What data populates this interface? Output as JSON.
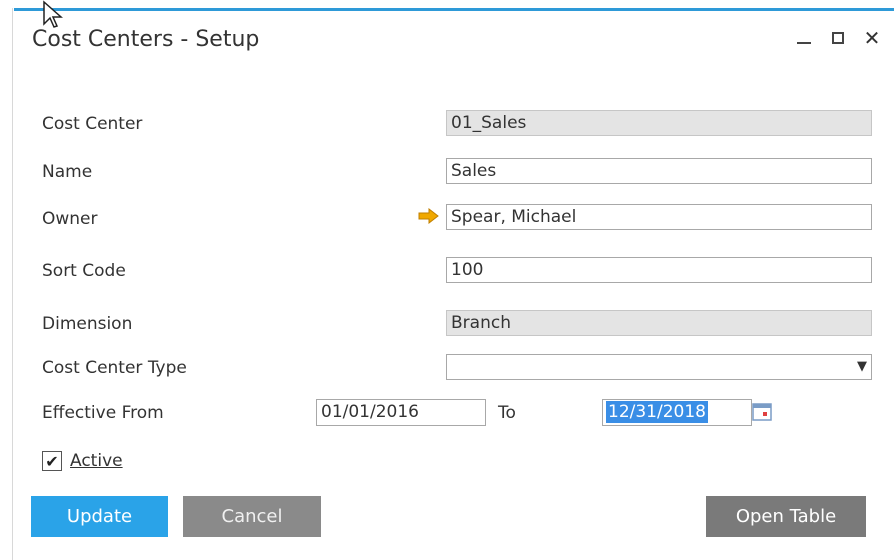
{
  "window": {
    "title": "Cost Centers - Setup",
    "controls": [
      "minimize-icon",
      "maximize-icon",
      "close-icon"
    ]
  },
  "form": {
    "cost_center": {
      "label": "Cost Center",
      "value": "01_Sales"
    },
    "name": {
      "label": "Name",
      "value": "Sales"
    },
    "owner": {
      "label": "Owner",
      "value": "Spear, Michael",
      "link_icon": "link-arrow-icon"
    },
    "sort_code": {
      "label": "Sort Code",
      "value": "100"
    },
    "dimension": {
      "label": "Dimension",
      "value": "Branch"
    },
    "cost_center_type": {
      "label": "Cost Center Type",
      "value": ""
    },
    "effective_from": {
      "label": "Effective From",
      "from_value": "01/01/2016",
      "to_label": "To",
      "to_value": "12/31/2018"
    },
    "active": {
      "label": "Active",
      "checked": true
    }
  },
  "buttons": {
    "update": "Update",
    "cancel": "Cancel",
    "open_table": "Open Table"
  },
  "colors": {
    "accent": "#2e9ad8",
    "primary_button": "#2aa3e8",
    "secondary_button": "#8a8a8a",
    "readonly_field": "#e4e4e4",
    "link_arrow": "#f0a800",
    "selection": "#3a8ee6"
  }
}
